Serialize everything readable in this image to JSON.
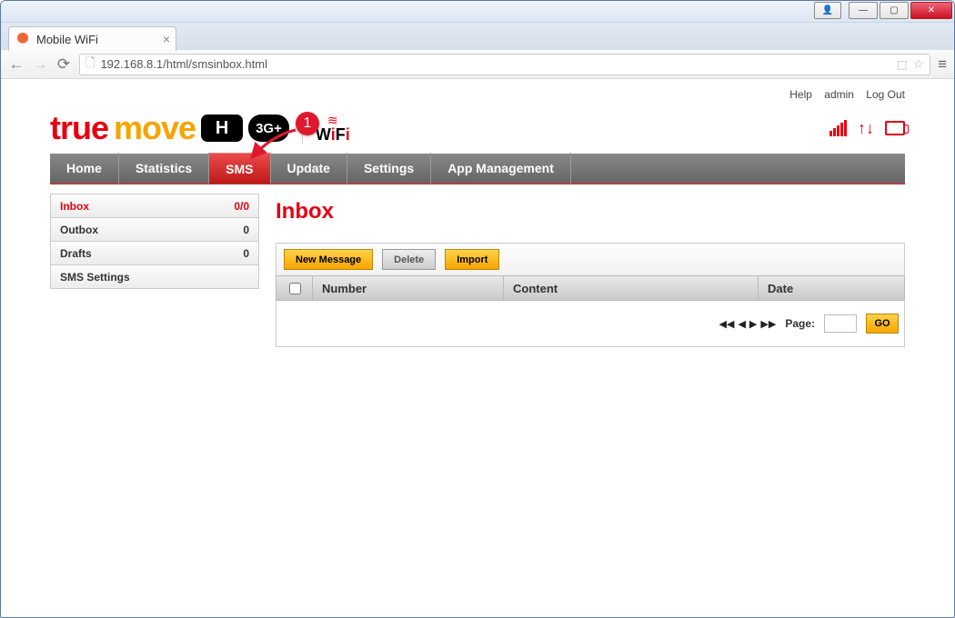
{
  "browser": {
    "tab_title": "Mobile WiFi",
    "url": "192.168.8.1/html/smsinbox.html"
  },
  "top_links": {
    "help": "Help",
    "admin": "admin",
    "logout": "Log Out"
  },
  "logo": {
    "true": "true",
    "move": "move",
    "h": "H",
    "g3": "3G+",
    "wifi_top": "≋",
    "wifi": "WiFi"
  },
  "nav": {
    "items": [
      {
        "label": "Home"
      },
      {
        "label": "Statistics"
      },
      {
        "label": "SMS"
      },
      {
        "label": "Update"
      },
      {
        "label": "Settings"
      },
      {
        "label": "App Management"
      }
    ],
    "active_index": 2
  },
  "annotation": {
    "step1": "1"
  },
  "sidebar": {
    "items": [
      {
        "label": "Inbox",
        "count": "0/0",
        "active": true
      },
      {
        "label": "Outbox",
        "count": "0"
      },
      {
        "label": "Drafts",
        "count": "0"
      },
      {
        "label": "SMS Settings",
        "count": ""
      }
    ]
  },
  "content": {
    "title": "Inbox",
    "buttons": {
      "new": "New Message",
      "delete": "Delete",
      "import": "Import"
    },
    "columns": {
      "number": "Number",
      "content": "Content",
      "date": "Date"
    },
    "pager": {
      "label": "Page:",
      "go": "GO",
      "value": ""
    }
  }
}
